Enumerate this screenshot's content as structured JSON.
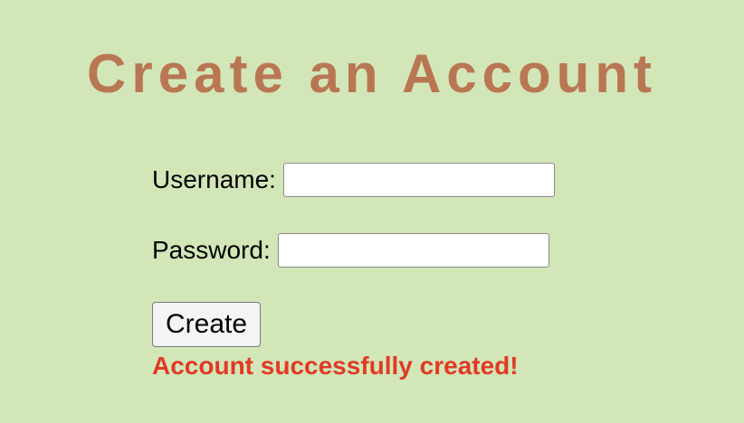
{
  "page": {
    "title": "Create an Account"
  },
  "form": {
    "username_label": "Username:",
    "username_value": "",
    "password_label": "Password:",
    "password_value": "",
    "create_label": "Create",
    "status_message": "Account successfully created!"
  },
  "colors": {
    "background": "#d3e6b8",
    "title": "#b87752",
    "status": "#e03a26"
  }
}
